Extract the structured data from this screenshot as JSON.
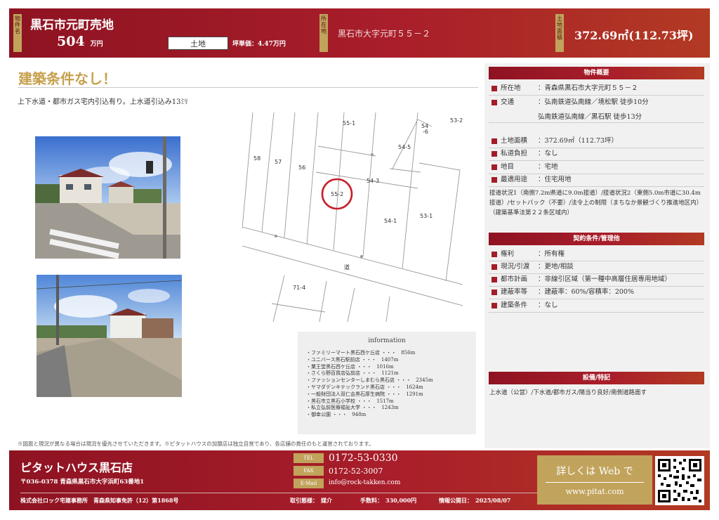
{
  "header": {
    "tag_name": "物件名",
    "title": "黒石市元町売地",
    "price": "504",
    "price_unit": "万円",
    "type": "土地",
    "tsubo_price": "坪単価：4.47万円",
    "tag_location": "所在地",
    "address": "黒石市大字元町５５－２",
    "tag_area": "土地面積",
    "area": "372.69㎡(112.73坪)"
  },
  "catch": "建築条件なし！",
  "description": "上下水道・都市ガス宅内引込有り。上水道引込み13ﾐﾘ",
  "map": {
    "road_label": "道",
    "lots": [
      "55-1",
      "54\n-6",
      "53-2",
      "54-5",
      "58",
      "57",
      "56",
      "54-3",
      "55-2",
      "54-1",
      "53-1",
      "71-4"
    ]
  },
  "information": {
    "title": "information",
    "items": [
      "・ファミリーマート黒石西ケ丘店 ・・・　856m",
      "・ユニバース黒石駅前店 ・・・　1407m",
      "・業王堂黒石西ケ丘店 ・・・　1016m",
      "・さくら野百貨店弘前店 ・・・　1121m",
      "・ファッションセンターしまむら黒石店 ・・・　2345m",
      "・ヤマダデンキテックランド黒石店 ・・・　1624m",
      "・一般財団法人双仁会黒石厚生病院 ・・・　1291m",
      "・黒石市立黒石小学校 ・・・　1517m",
      "・私立弘前医療福祉大学 ・・・　1243m",
      "・御幸公園 ・・・　948m"
    ]
  },
  "footnote": "※図面と現況が異なる場合は現況を優先させていただきます。※ピタットハウスの加盟店は独立自営であり、各店舗の責任のもと運営されております。",
  "overview": {
    "title": "物件概要",
    "rows": [
      {
        "label": "所在地",
        "value": "：青森県黒石市大字元町５５－２"
      },
      {
        "label": "交通",
        "value": "：弘南鉄道弘南線／境松駅 徒歩10分",
        "value2": "弘南鉄道弘南線／黒石駅 徒歩13分"
      },
      {
        "label": "土地面積",
        "value": "：372.69㎡（112.73坪）"
      },
      {
        "label": "私道負担",
        "value": "：なし"
      },
      {
        "label": "地目",
        "value": "：宅地"
      },
      {
        "label": "最適用途",
        "value": "：住宅用地"
      }
    ],
    "note": "接道状況1（南側7.2m県道に9.0m接道）/接道状況2（東側5.0m市道に30.4m接道）/セットバック（不要）/法令上の制限（まちなか景観づくり推進地区内）（建築基準法第２２条区域内）"
  },
  "contract": {
    "title": "契約条件/管理他",
    "rows": [
      {
        "label": "権利",
        "value": "：所有権"
      },
      {
        "label": "現況/引渡",
        "value": "：更地/相談"
      },
      {
        "label": "都市計画",
        "value": "：非線引区域（第一種中高層住居専用地域）"
      },
      {
        "label": "建蔽率等",
        "value": "：建蔽率：60%/容積率：200%"
      },
      {
        "label": "建築条件",
        "value": "：なし"
      }
    ]
  },
  "facilities": {
    "title": "設備/特記",
    "text": "上水道（公営）/下水道/都市ガス/陽当り良好/南側道路面す"
  },
  "footer": {
    "company": "ピタットハウス黒石店",
    "address": "〒036-0378 青森県黒石市大字浜町63番地1",
    "license": "株式会社ロック宅建事務所　青森県知事免許（12）第1868号",
    "tel_tag": "TEL",
    "tel": "0172-53-0330",
    "fax_tag": "FAX",
    "fax": "0172-52-3007",
    "email_tag": "E-Mail",
    "email": "info@rock-takken.com",
    "transaction": "取引態様：　媒介",
    "fee": "手数料：　330,000円",
    "published": "情報公開日：　2025/08/07",
    "web_text": "詳しくは Web で",
    "web_url": "www.pitat.com"
  },
  "colors": {
    "brand_red": "#a41c29",
    "gold": "#c1a35c"
  }
}
